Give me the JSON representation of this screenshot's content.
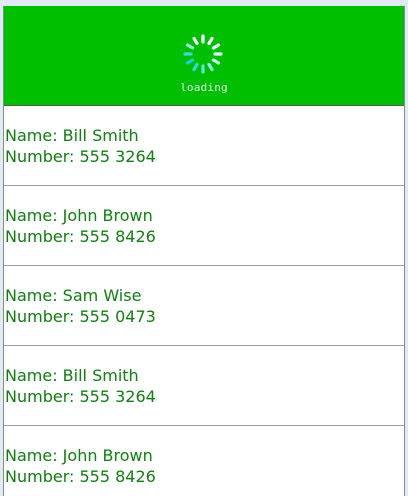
{
  "header": {
    "loading_text": "loading",
    "spinner_icon": "loading-spinner-icon",
    "background_color": "#00bf00"
  },
  "contacts": [
    {
      "name": "Name: Bill Smith",
      "number": "Number: 555 3264"
    },
    {
      "name": "Name: John Brown",
      "number": "Number: 555 8426"
    },
    {
      "name": "Name: Sam Wise",
      "number": "Number: 555 0473"
    },
    {
      "name": "Name: Bill Smith",
      "number": "Number: 555 3264"
    },
    {
      "name": "Name: John Brown",
      "number": "Number: 555 8426"
    }
  ],
  "colors": {
    "text_green": "#0f7f0f",
    "divider": "#9a9a9a"
  }
}
